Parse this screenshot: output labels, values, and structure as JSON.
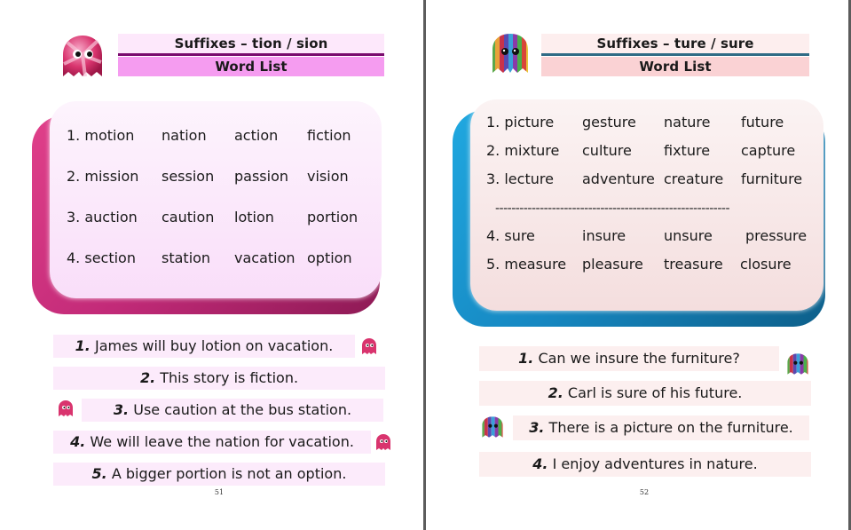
{
  "pages": [
    {
      "title": "Suffixes – tion / sion",
      "subtitle": "Word List",
      "page_number": "51",
      "mascot": "candy-ghost-icon",
      "colors": {
        "title_bg": "#fde8fb",
        "title_bar": "#7a0a6e",
        "subtitle_bg": "#f59cf0",
        "card_bg": "#fbe1fb",
        "card_shadow": "#c22a78",
        "sentence_bg": "#fcebfb"
      },
      "word_rows": [
        [
          "1. motion",
          "nation",
          "action",
          "fiction"
        ],
        [
          "2. mission",
          "session",
          "passion",
          "vision"
        ],
        [
          "3. auction",
          "caution",
          "lotion",
          "portion"
        ],
        [
          "4. section",
          "station",
          "vacation",
          "option"
        ]
      ],
      "sentences": [
        {
          "num": "1.",
          "text": " James will buy lotion on vacation."
        },
        {
          "num": "2.",
          "text": " This story is fiction."
        },
        {
          "num": "3.",
          "text": " Use caution at the bus station."
        },
        {
          "num": "4.",
          "text": " We will leave the nation for vacation."
        },
        {
          "num": "5.",
          "text": " A bigger portion is not an option."
        }
      ]
    },
    {
      "title": "Suffixes – ture / sure",
      "subtitle": "Word List",
      "page_number": "52",
      "mascot": "striped-ghost-icon",
      "colors": {
        "title_bg": "#fdeeee",
        "title_bar": "#2f6b85",
        "subtitle_bg": "#fad2d4",
        "card_bg": "#f6e2e2",
        "card_shadow": "#1688c2",
        "sentence_bg": "#fcefef"
      },
      "word_rows": [
        [
          "1. picture",
          "gesture",
          "nature",
          "future"
        ],
        [
          "2. mixture",
          "culture",
          "fixture",
          "capture"
        ],
        [
          "3. lecture",
          "adventure",
          "creature",
          "furniture"
        ],
        [
          "4. sure",
          "insure",
          "unsure",
          "pressure"
        ],
        [
          "5. measure",
          "pleasure",
          "treasure",
          "closure"
        ]
      ],
      "separator": "----------------------------------------------------------",
      "sentences": [
        {
          "num": "1.",
          "text": " Can we insure the furniture?"
        },
        {
          "num": "2.",
          "text": " Carl is sure of his future."
        },
        {
          "num": "3.",
          "text": " There is a picture on the furniture."
        },
        {
          "num": "4.",
          "text": " I enjoy adventures in nature."
        }
      ]
    }
  ]
}
